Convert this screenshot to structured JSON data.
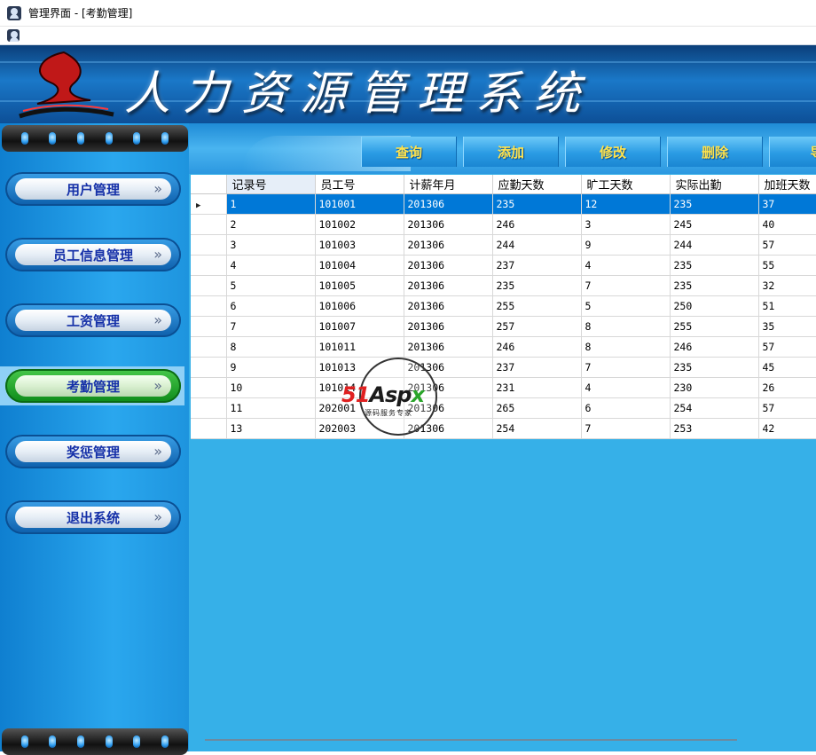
{
  "window": {
    "title": "管理界面 - [考勤管理]"
  },
  "banner": {
    "title": "人力资源管理系统"
  },
  "sidebar": {
    "items": [
      {
        "label": "用户管理",
        "active": false
      },
      {
        "label": "员工信息管理",
        "active": false
      },
      {
        "label": "工资管理",
        "active": false
      },
      {
        "label": "考勤管理",
        "active": true
      },
      {
        "label": "奖惩管理",
        "active": false
      },
      {
        "label": "退出系统",
        "active": false
      }
    ],
    "chevron": "»"
  },
  "toolbar": {
    "buttons": [
      "查询",
      "添加",
      "修改",
      "删除",
      "导"
    ]
  },
  "grid": {
    "columns": [
      "记录号",
      "员工号",
      "计薪年月",
      "应勤天数",
      "旷工天数",
      "实际出勤",
      "加班天数"
    ],
    "selected_row": 0,
    "rows": [
      [
        "1",
        "101001",
        "201306",
        "235",
        "12",
        "235",
        "37"
      ],
      [
        "2",
        "101002",
        "201306",
        "246",
        "3",
        "245",
        "40"
      ],
      [
        "3",
        "101003",
        "201306",
        "244",
        "9",
        "244",
        "57"
      ],
      [
        "4",
        "101004",
        "201306",
        "237",
        "4",
        "235",
        "55"
      ],
      [
        "5",
        "101005",
        "201306",
        "235",
        "7",
        "235",
        "32"
      ],
      [
        "6",
        "101006",
        "201306",
        "255",
        "5",
        "250",
        "51"
      ],
      [
        "7",
        "101007",
        "201306",
        "257",
        "8",
        "255",
        "35"
      ],
      [
        "8",
        "101011",
        "201306",
        "246",
        "8",
        "246",
        "57"
      ],
      [
        "9",
        "101013",
        "201306",
        "237",
        "7",
        "235",
        "45"
      ],
      [
        "10",
        "101014",
        "201306",
        "231",
        "4",
        "230",
        "26"
      ],
      [
        "11",
        "202001",
        "201306",
        "265",
        "6",
        "254",
        "57"
      ],
      [
        "13",
        "202003",
        "201306",
        "254",
        "7",
        "253",
        "42"
      ]
    ]
  },
  "watermark": {
    "brand_a": "51",
    "brand_b": "Asp",
    "brand_c": "x",
    "sub": "源码服务专家"
  },
  "colors": {
    "selection": "#0078d7",
    "toolbar_text": "#ffe34d",
    "nav_text": "#1530a8",
    "content_bg": "#36b0e8"
  }
}
